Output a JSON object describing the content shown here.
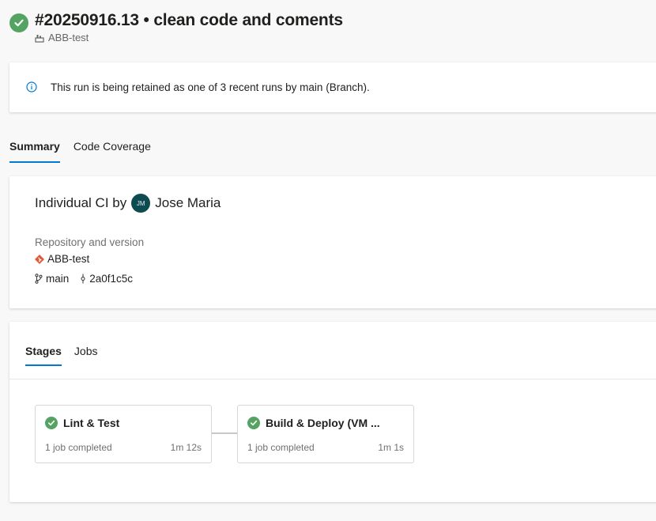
{
  "run": {
    "title": "#20250916.13 • clean code and coments",
    "pipeline": "ABB-test",
    "status_color": "#55a362"
  },
  "banner": {
    "icon": "info-icon",
    "message": "This run is being retained as one of 3 recent runs by main (Branch)."
  },
  "tabs": [
    {
      "label": "Summary",
      "active": true
    },
    {
      "label": "Code Coverage",
      "active": false
    }
  ],
  "summary": {
    "trigger_prefix": "Individual CI by",
    "user_initials": "JM",
    "user_name": "Jose Maria",
    "repo_label": "Repository and version",
    "repo_name": "ABB-test",
    "branch": "main",
    "commit": "2a0f1c5c"
  },
  "stage_tabs": [
    {
      "label": "Stages",
      "active": true
    },
    {
      "label": "Jobs",
      "active": false
    }
  ],
  "stages": [
    {
      "name": "Lint & Test",
      "jobs": "1 job completed",
      "duration": "1m 12s",
      "status": "succeeded"
    },
    {
      "name": "Build & Deploy (VM ...",
      "jobs": "1 job completed",
      "duration": "1m 1s",
      "status": "succeeded"
    }
  ],
  "colors": {
    "accent": "#0078d4",
    "success": "#55a362",
    "avatar": "#0d4b50",
    "git": "#e05a3a"
  }
}
